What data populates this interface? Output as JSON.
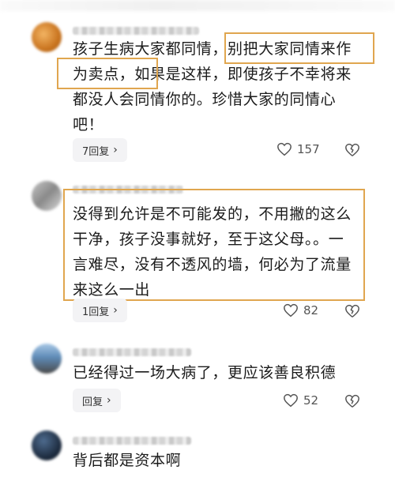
{
  "comments": [
    {
      "lines": [
        "孩子生病大家都同情，别把大家同情来作",
        "为卖点，如果是这样，即使孩子不幸将来",
        "都没人会同情你的。珍惜大家的同情心",
        "吧！"
      ],
      "reply_label": "7回复",
      "likes": "157"
    },
    {
      "lines": [
        "没得到允许是不可能发的，不用撇的这么",
        "干净，孩子没事就好，至于这父母。。一",
        "言难尽，没有不透风的墙，何必为了流量",
        "来这么一出"
      ],
      "reply_label": "1回复",
      "likes": "82"
    },
    {
      "lines": [
        "已经得过一场大病了，更应该善良积德"
      ],
      "reply_label": "回复",
      "likes": "52"
    },
    {
      "lines": [
        "背后都是资本啊"
      ]
    }
  ],
  "colors": {
    "highlight": "#e0a64f",
    "reply_bg": "#f3f3f5"
  }
}
